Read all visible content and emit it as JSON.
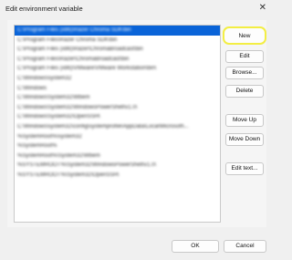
{
  "window": {
    "title": "Edit environment variable",
    "close_glyph": "✕"
  },
  "paths": [
    "C:\\Program Files (x86)\\Razer Chroma SDK\\bin",
    "C:\\Program Files\\Razer Chroma SDK\\bin",
    "C:\\Program Files (x86)\\Razer\\ChromaBroadcast\\bin",
    "C:\\Program Files\\Razer\\ChromaBroadcast\\bin",
    "C:\\Program Files (x86)\\VMware\\VMware Workstation\\bin\\",
    "C:\\Windows\\system32",
    "C:\\Windows",
    "C:\\Windows\\System32\\Wbem",
    "C:\\Windows\\System32\\WindowsPowerShell\\v1.0\\",
    "C:\\Windows\\System32\\OpenSSH\\",
    "C:\\Windows\\system32\\config\\systemprofile\\AppData\\Local\\Microsoft\\...",
    "%SystemRoot%\\system32",
    "%SystemRoot%",
    "%SystemRoot%\\System32\\Wbem",
    "%SYSTEMROOT%\\System32\\WindowsPowerShell\\v1.0\\",
    "%SYSTEMROOT%\\System32\\OpenSSH\\"
  ],
  "buttons": {
    "new": "New",
    "edit": "Edit",
    "browse": "Browse...",
    "delete": "Delete",
    "move_up": "Move Up",
    "move_down": "Move Down",
    "edit_text": "Edit text..."
  },
  "footer": {
    "ok": "OK",
    "cancel": "Cancel"
  },
  "colors": {
    "selection": "#0a64d8",
    "highlight_ring": "#f3ee43"
  }
}
